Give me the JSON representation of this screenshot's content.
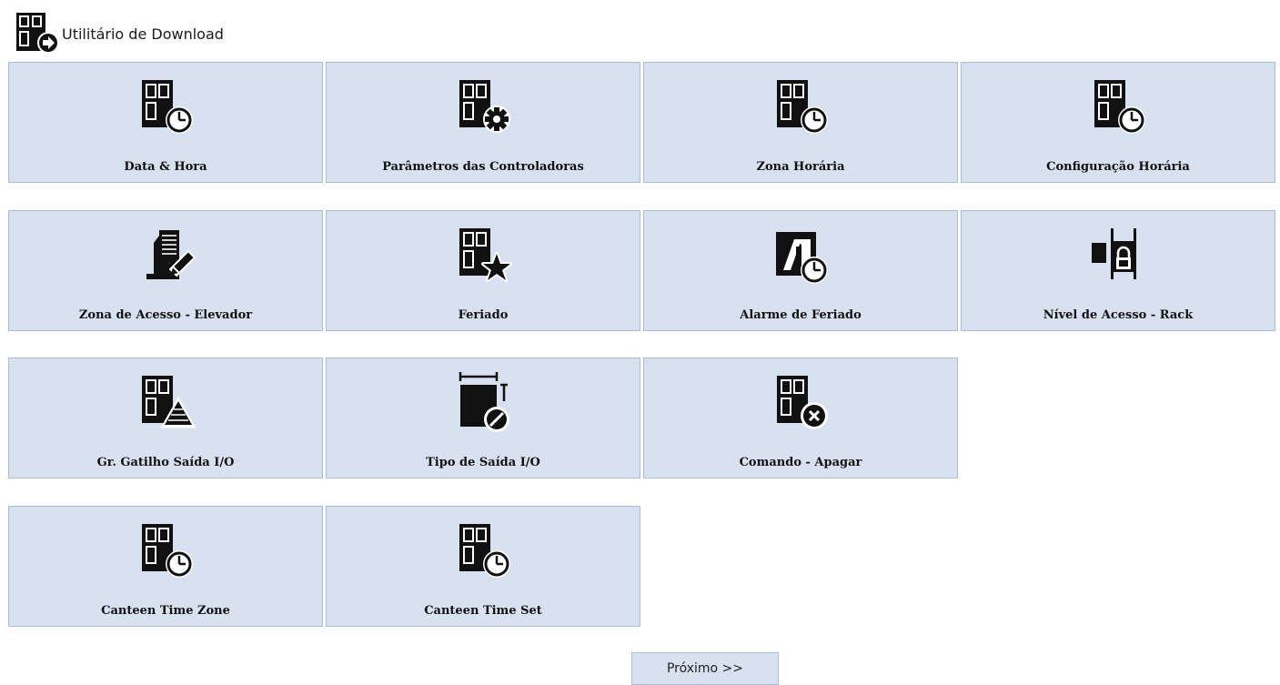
{
  "header": {
    "title": "Utilitário de Download",
    "icon": "download-utility-icon"
  },
  "tiles": [
    {
      "label": "Data & Hora",
      "icon": "door-clock-icon"
    },
    {
      "label": "Parâmetros das Controladoras",
      "icon": "door-gear-icon"
    },
    {
      "label": "Zona Horária",
      "icon": "door-clock-icon"
    },
    {
      "label": "Configuração Horária",
      "icon": "door-clock-icon"
    },
    {
      "label": "Zona de Acesso - Elevador",
      "icon": "building-pencil-icon"
    },
    {
      "label": "Feriado",
      "icon": "door-star-icon"
    },
    {
      "label": "Alarme de Feriado",
      "icon": "alarm-clock-icon"
    },
    {
      "label": "Nível de Acesso - Rack",
      "icon": "rack-lock-icon"
    },
    {
      "label": "Gr. Gatilho Saída I/O",
      "icon": "door-pyramid-icon"
    },
    {
      "label": "Tipo de Saída I/O",
      "icon": "output-type-icon"
    },
    {
      "label": "Comando - Apagar",
      "icon": "door-delete-icon"
    },
    {
      "label": "Canteen Time Zone",
      "icon": "door-clock-icon"
    },
    {
      "label": "Canteen Time Set",
      "icon": "door-clock-icon"
    }
  ],
  "next_button": {
    "label": "Próximo >>"
  },
  "colors": {
    "tile_bg": "#d7e1ef",
    "tile_border": "#a9bdd6",
    "icon": "#111111"
  }
}
